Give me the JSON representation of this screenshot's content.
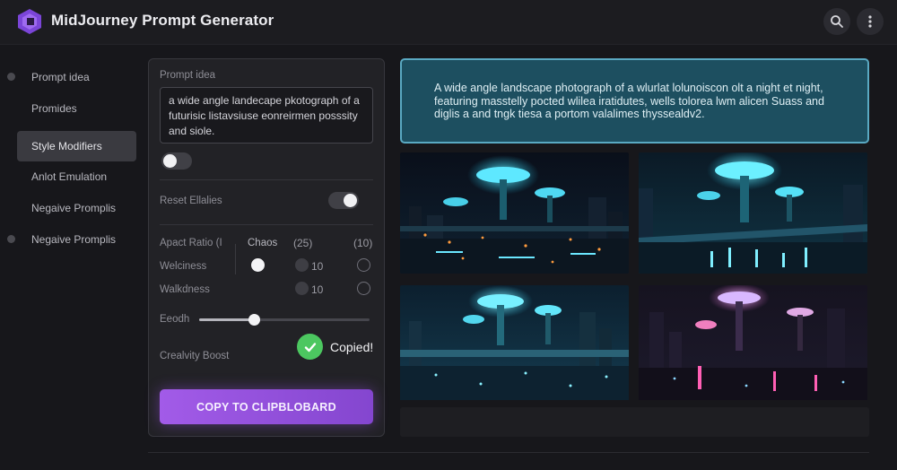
{
  "header": {
    "title": "MidJourney Prompt Generator",
    "search_icon": "search-icon",
    "more_icon": "more-vertical-icon",
    "logo_icon": "hexagon-logo-icon"
  },
  "sidebar": {
    "items": [
      {
        "label": "Prompt idea",
        "dot": true
      },
      {
        "label": "Promides",
        "dot": false
      },
      {
        "label": "Style Modifiers",
        "active": true
      },
      {
        "label": "Anlot Emulation",
        "dot": false
      },
      {
        "label": "Negaive Promplis",
        "dot": false
      },
      {
        "label": "Negaive Promplis",
        "dot": true
      }
    ]
  },
  "panel": {
    "prompt_label": "Prompt idea",
    "prompt_value": "a wide angle landecape pkotograph of a futurisic listavsiuse eonreirmen posssity and siole.",
    "reset_label": "Reset Ellalies",
    "aspect_label": "Apact Ratio (I",
    "chaos_label": "Chaos",
    "chaos_value": "(25)",
    "extra_value": "(10)",
    "weirdness_label_1": "Welciness",
    "weirdness_label_2": "Walkdness",
    "option_value_1": "10",
    "option_value_2": "10",
    "seed_label": "Eeodh",
    "seed_level": 0.32,
    "creativity_label": "Crealvity Boost",
    "copied_label": "Copied!",
    "copy_button": "COPY TO CLIPBLOBARD"
  },
  "output": {
    "text": "A wide angle landscape photograph of a wlurlat lolunoiscon olt a night et night, featuring masstelly pocted wlilea iratidutes, wells tolorea lwm alicen Suass and diglis a and tngk tiesa a portom valalimes thyssealdv2."
  },
  "gallery": {
    "images": [
      {
        "name": "cyber-city-image-1",
        "palette": "cyan-orange"
      },
      {
        "name": "cyber-city-image-2",
        "palette": "cyan"
      },
      {
        "name": "cyber-city-image-3",
        "palette": "teal"
      },
      {
        "name": "cyber-city-image-4",
        "palette": "pink"
      }
    ]
  },
  "colors": {
    "accent_purple": "#9b55e2",
    "output_bg": "#1d4f60",
    "output_border": "#5aa9c2",
    "check_green": "#4cc760"
  }
}
